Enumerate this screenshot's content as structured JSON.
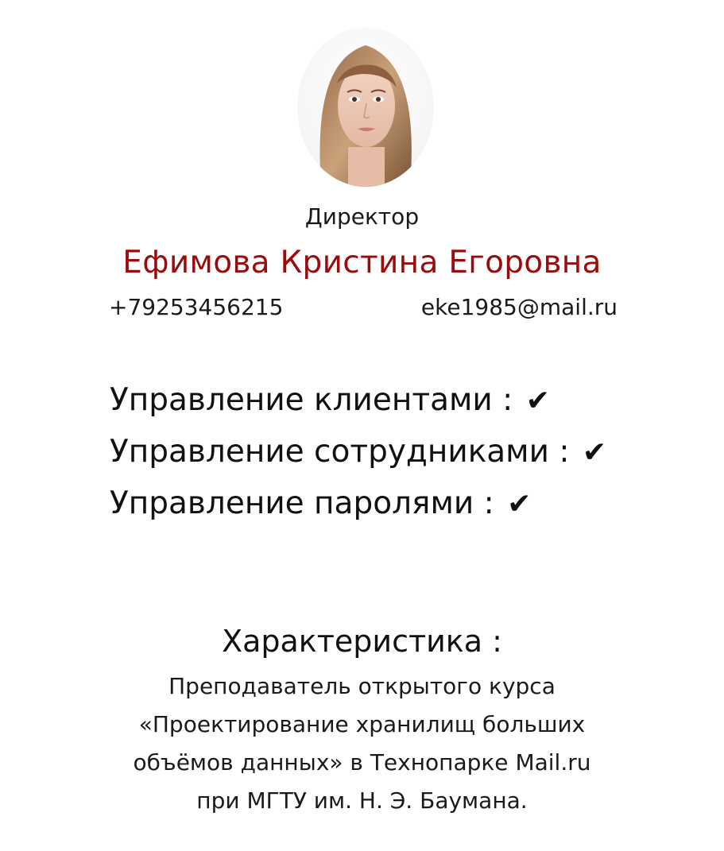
{
  "profile": {
    "role": "Директор",
    "full_name": "Ефимова Кристина Егоровна",
    "phone": "+79253456215",
    "email": "eke1985@mail.ru"
  },
  "permissions": [
    {
      "label": "Управление клиентами :",
      "icon": "check-icon",
      "granted": true
    },
    {
      "label": "Управление сотрудниками :",
      "icon": "check-icon",
      "granted": true
    },
    {
      "label": "Управление паролями :",
      "icon": "check-icon",
      "granted": true
    }
  ],
  "check_glyph": "✔",
  "characteristic": {
    "title": "Характеристика :",
    "lines": [
      "Преподаватель открытого курса",
      "«Проектирование хранилищ больших",
      "объёмов данных» в Технопарке Mail.ru",
      "при МГТУ им. Н. Э. Баумана."
    ]
  },
  "colors": {
    "name_accent": "#9b0b0b",
    "text": "#111111",
    "background": "#ffffff"
  }
}
